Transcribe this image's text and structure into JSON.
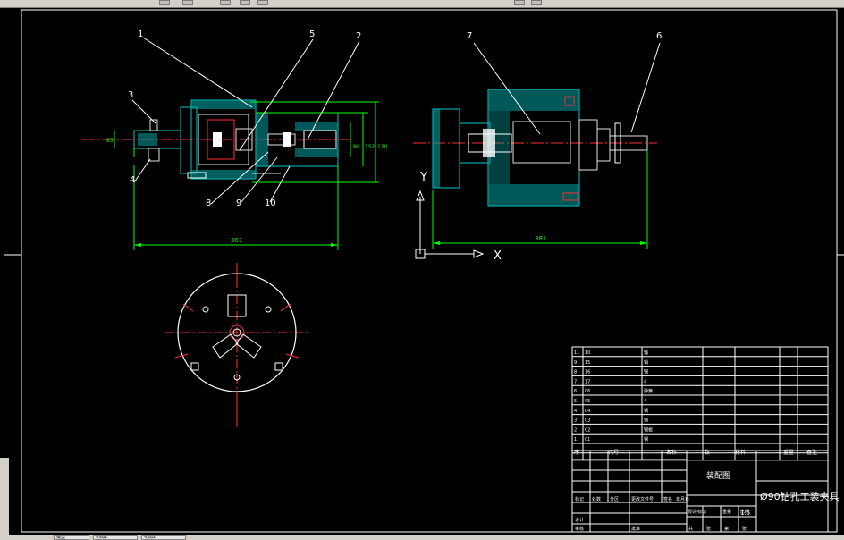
{
  "toolbar": {
    "icons": [
      "layer-icon",
      "print-icon",
      "zoom-icon",
      "pan-icon",
      "help-icon"
    ]
  },
  "views": {
    "front": {
      "leaders": [
        "1",
        "5",
        "2",
        "3",
        "4",
        "8",
        "9",
        "10"
      ],
      "dim_length": "361",
      "dim_height_left": "85",
      "dim_height_a": "80",
      "dim_height_b": "152",
      "dim_height_c": "120"
    },
    "side": {
      "leaders": [
        "7",
        "6"
      ],
      "dim_length": "381",
      "axis_y": "Y",
      "axis_x": "X"
    }
  },
  "parts_list": {
    "rows": [
      {
        "no": "11",
        "code": "10",
        "name": "轴",
        "qty": ""
      },
      {
        "no": "9",
        "code": "15",
        "name": "销",
        "qty": ""
      },
      {
        "no": "8",
        "code": "16",
        "name": "钢",
        "qty": ""
      },
      {
        "no": "7",
        "code": "17",
        "name": "4",
        "qty": ""
      },
      {
        "no": "6",
        "code": "06",
        "name": "弹簧",
        "qty": ""
      },
      {
        "no": "5",
        "code": "05",
        "name": "4",
        "qty": ""
      },
      {
        "no": "4",
        "code": "04",
        "name": "钢",
        "qty": ""
      },
      {
        "no": "3",
        "code": "03",
        "name": "钢",
        "qty": ""
      },
      {
        "no": "2",
        "code": "02",
        "name": "钢板",
        "qty": ""
      },
      {
        "no": "1",
        "code": "01",
        "name": "钢",
        "qty": ""
      }
    ],
    "header": {
      "no": "序",
      "code": "代号",
      "name": "名称",
      "qty": "数",
      "material": "材料",
      "weight": "重量",
      "remark": "备注"
    }
  },
  "title_block": {
    "drawing_name": "装配图",
    "part_title": "Ø90钻孔工装夹具",
    "scale": "1:5",
    "row_labels": [
      "标记",
      "处数",
      "分区",
      "更改文件号",
      "签名",
      "年月日"
    ],
    "stage_labels": [
      "阶段标记",
      "重量",
      "比例"
    ],
    "sign_labels": [
      "设计",
      "审核",
      "工艺",
      "批准"
    ],
    "sheet_labels": [
      "共",
      "张",
      "第",
      "张"
    ]
  },
  "status_tabs": [
    "模型",
    "布局1",
    "布局2"
  ]
}
